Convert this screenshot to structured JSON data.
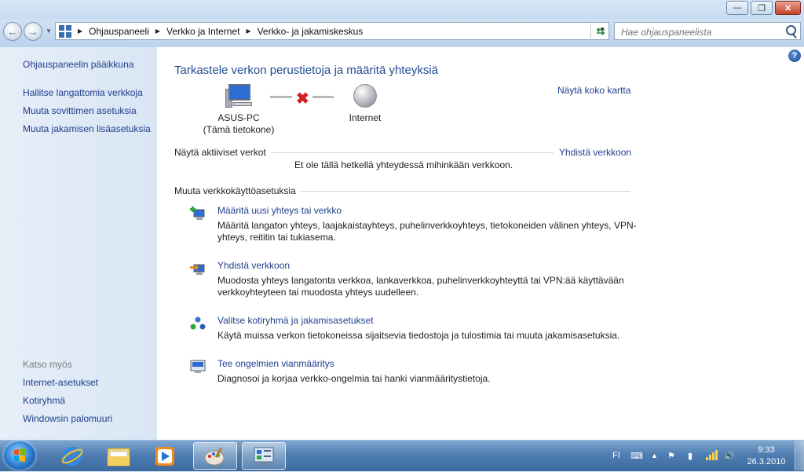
{
  "window": {
    "buttons": {
      "minimize": "—",
      "maximize": "❐",
      "close": "✕"
    }
  },
  "address_bar": {
    "crumbs": [
      "Ohjauspaneeli",
      "Verkko ja Internet",
      "Verkko- ja jakamiskeskus"
    ],
    "search_placeholder": "Hae ohjauspaneelista"
  },
  "sidebar": {
    "home": "Ohjauspaneelin pääikkuna",
    "links": [
      "Hallitse langattomia verkkoja",
      "Muuta sovittimen asetuksia",
      "Muuta jakamisen lisäasetuksia"
    ],
    "see_also_header": "Katso myös",
    "see_also": [
      "Internet-asetukset",
      "Kotiryhmä",
      "Windowsin palomuuri"
    ]
  },
  "main": {
    "title": "Tarkastele verkon perustietoja ja määritä yhteyksiä",
    "map": {
      "computer_name": "ASUS-PC",
      "computer_sub": "(Tämä tietokone)",
      "internet": "Internet",
      "full_map_link": "Näytä koko kartta"
    },
    "active_networks": {
      "header": "Näytä aktiiviset verkot",
      "connect_link": "Yhdistä verkkoon",
      "message": "Et ole tällä hetkellä yhteydessä mihinkään verkkoon."
    },
    "change_settings": {
      "header": "Muuta verkkokäyttöasetuksia",
      "tasks": [
        {
          "link": "Määritä uusi yhteys tai verkko",
          "desc": "Määritä langaton yhteys, laajakaistayhteys, puhelinverkkoyhteys, tietokoneiden välinen yhteys, VPN-yhteys, reititin tai tukiasema.",
          "icon": "new-connection-icon"
        },
        {
          "link": "Yhdistä verkkoon",
          "desc": "Muodosta yhteys langatonta verkkoa, lankaverkkoa, puhelinverkkoyhteyttä tai VPN:ää käyttävään verkkoyhteyteen tai muodosta yhteys uudelleen.",
          "icon": "connect-network-icon"
        },
        {
          "link": "Valitse kotiryhmä ja jakamisasetukset",
          "desc": "Käytä muissa verkon tietokoneissa sijaitsevia tiedostoja ja tulostimia tai muuta jakamisasetuksia.",
          "icon": "homegroup-icon"
        },
        {
          "link": "Tee ongelmien vianmääritys",
          "desc": "Diagnosoi ja korjaa verkko-ongelmia tai hanki vianmääritystietoja.",
          "icon": "troubleshoot-icon"
        }
      ]
    }
  },
  "help_glyph": "?",
  "taskbar": {
    "language": "FI",
    "time": "9:33",
    "date": "26.3.2010",
    "apps": [
      "internet-explorer-icon",
      "windows-explorer-icon",
      "media-player-icon",
      "paint-icon",
      "control-panel-icon"
    ]
  }
}
